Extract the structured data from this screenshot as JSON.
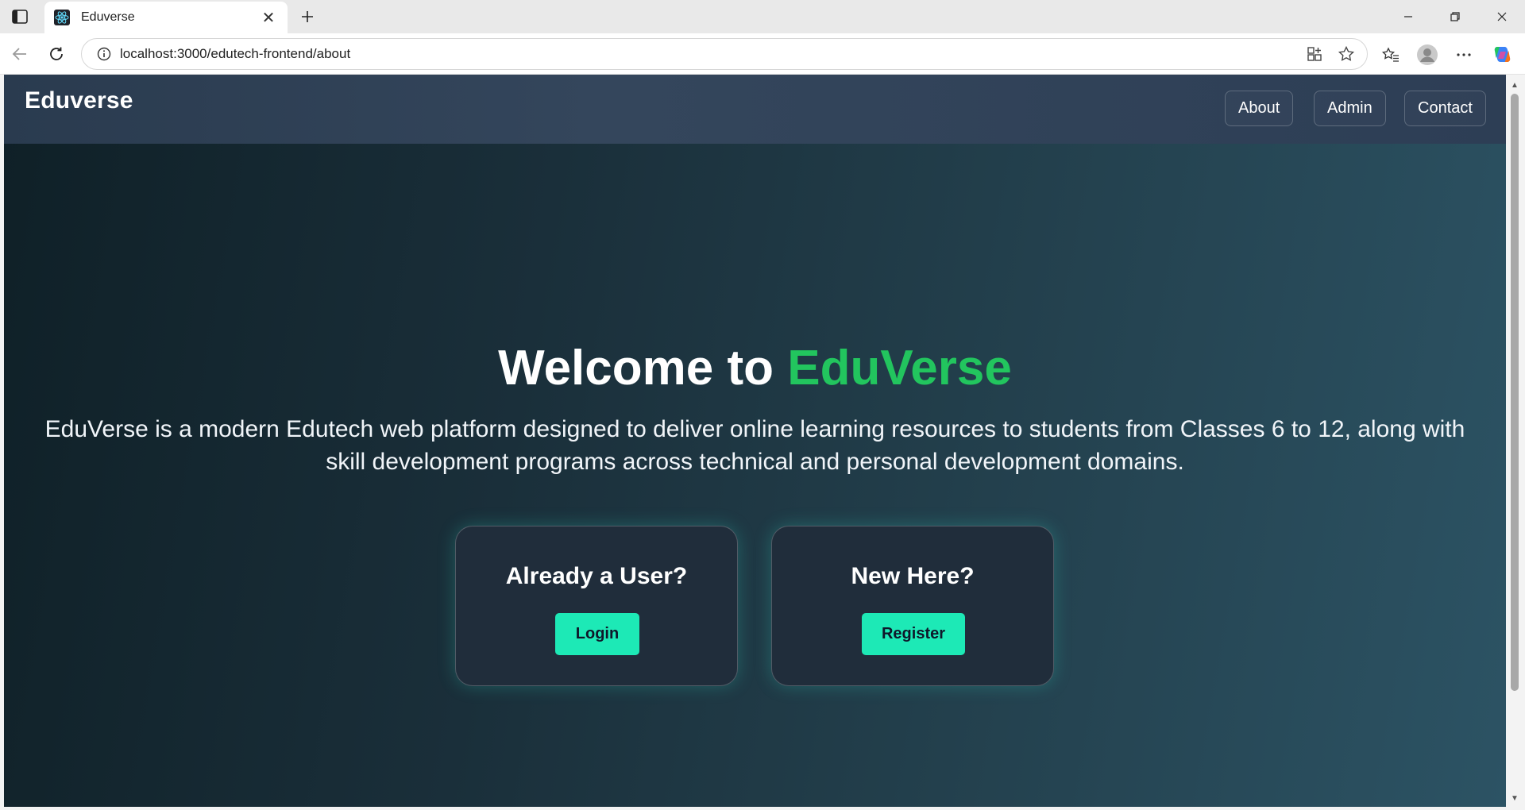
{
  "browser": {
    "tab": {
      "title": "Eduverse",
      "favicon": "react-logo-icon",
      "close_glyph": "✕"
    },
    "new_tab_glyph": "+",
    "address": {
      "url": "localhost:3000/edutech-frontend/about"
    },
    "window_controls": [
      "minimize",
      "restore",
      "close"
    ]
  },
  "site": {
    "brand": "Eduverse",
    "nav": [
      {
        "label": "About"
      },
      {
        "label": "Admin"
      },
      {
        "label": "Contact"
      }
    ],
    "hero": {
      "title_prefix": "Welcome to",
      "title_accent": "EduVerse",
      "accent_color": "#22c55e",
      "description": "EduVerse is a modern Edutech web platform designed to deliver online learning resources to students from Classes 6 to 12, along with skill development programs across technical and personal development domains."
    },
    "cards": [
      {
        "heading": "Already a User?",
        "button": "Login"
      },
      {
        "heading": "New Here?",
        "button": "Register"
      }
    ],
    "button_color": "#1de9b6"
  }
}
